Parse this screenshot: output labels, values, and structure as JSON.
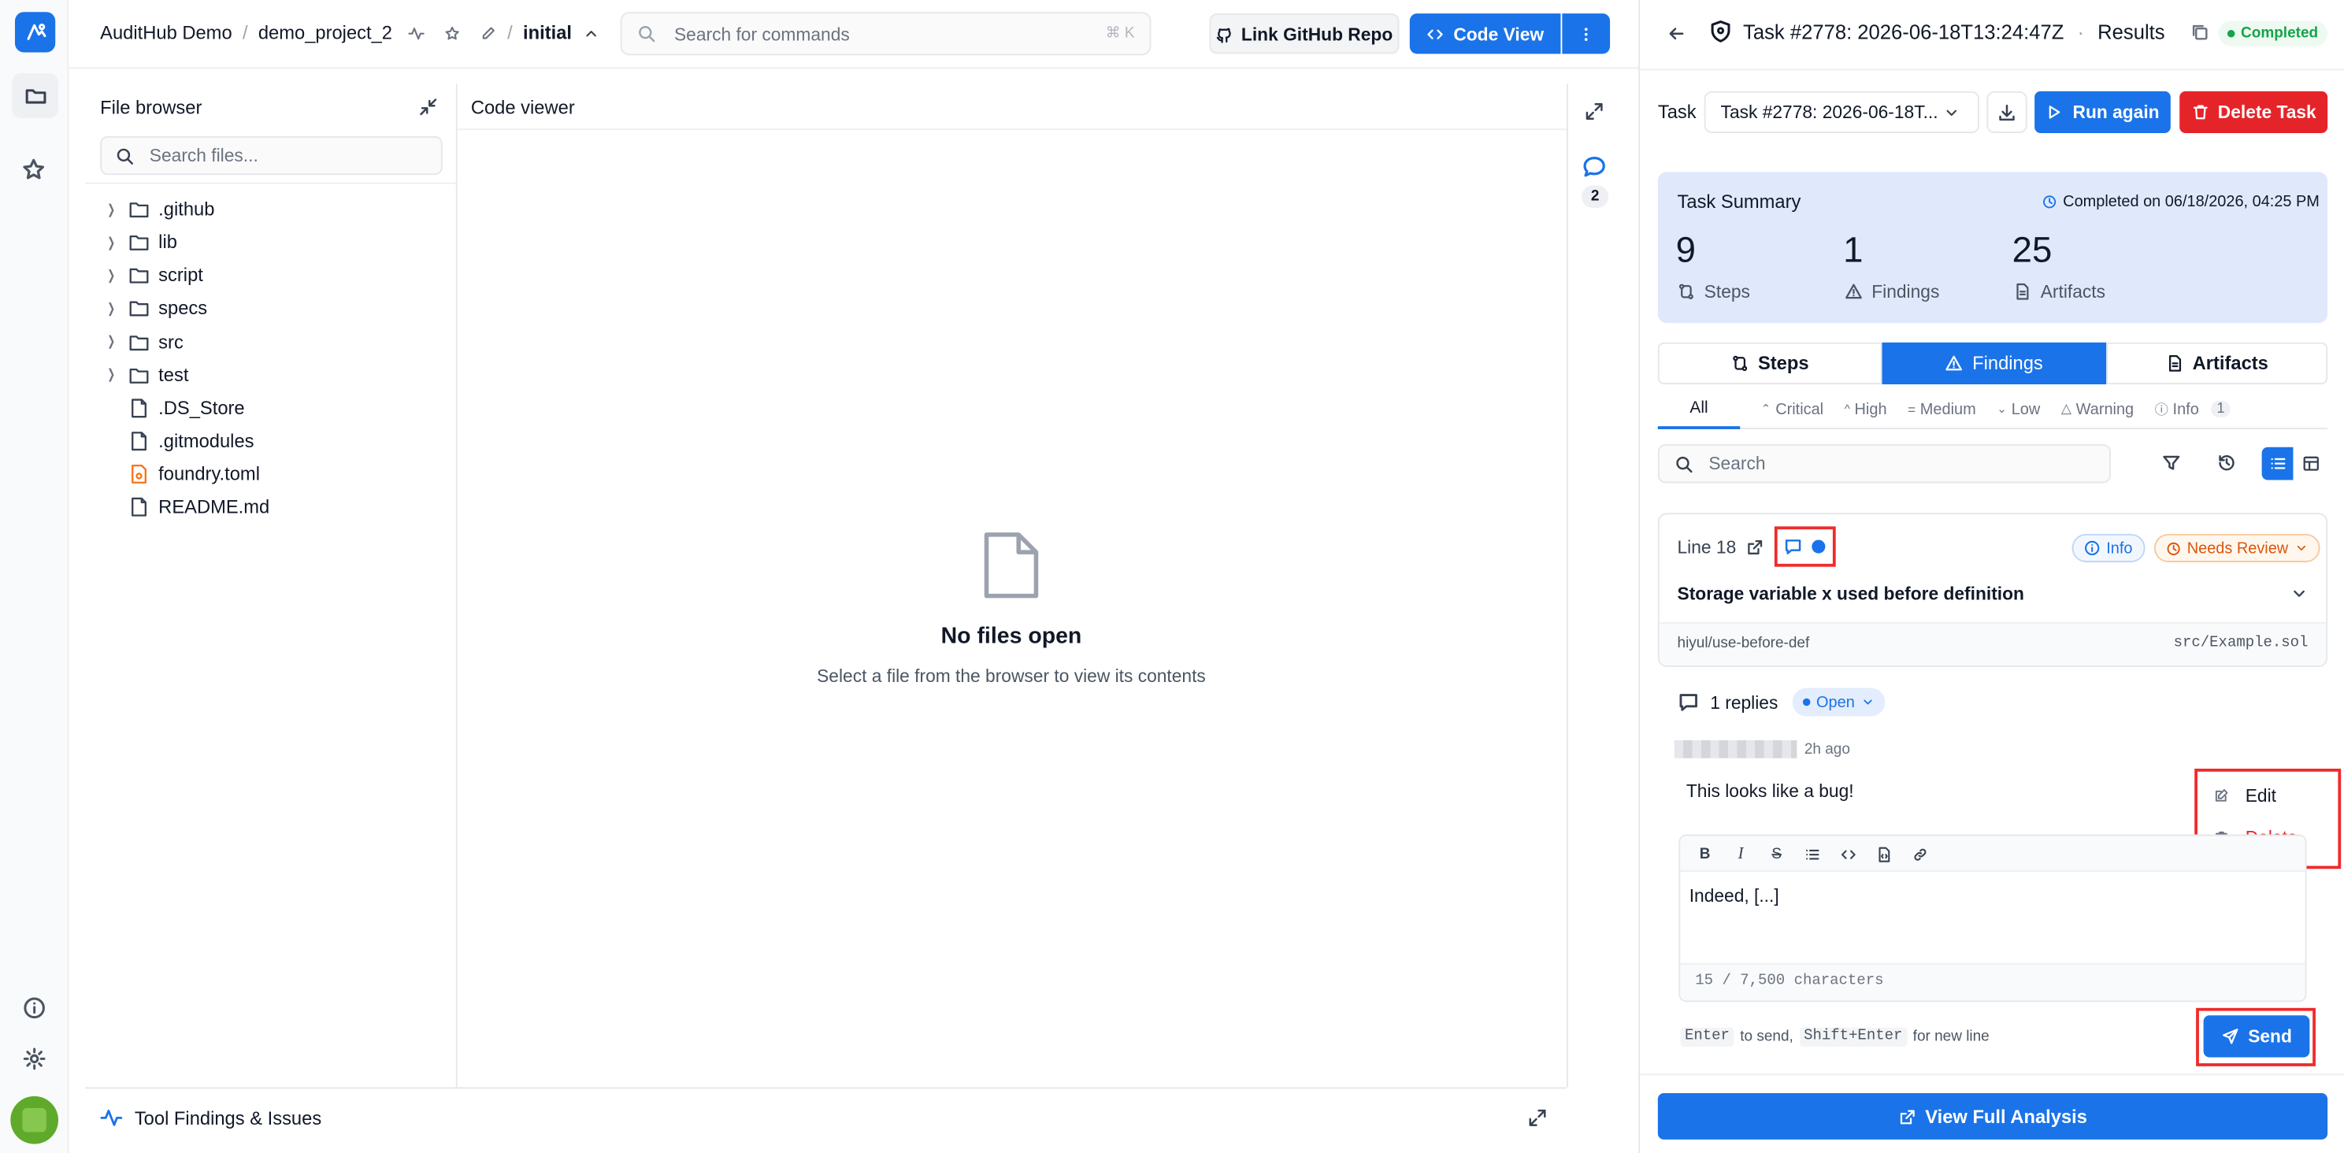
{
  "topbar": {
    "project": "AuditHub Demo",
    "sep1": "/",
    "repo": "demo_project_2",
    "sep2": "/",
    "branch": "initial",
    "command_placeholder": "Search for commands",
    "command_shortcut": "⌘ K",
    "link_github_label": "Link GitHub Repo",
    "code_view_label": "Code View"
  },
  "file_browser": {
    "title": "File browser",
    "search_placeholder": "Search files...",
    "items": [
      {
        "name": ".github",
        "type": "folder"
      },
      {
        "name": "lib",
        "type": "folder"
      },
      {
        "name": "script",
        "type": "folder"
      },
      {
        "name": "specs",
        "type": "folder"
      },
      {
        "name": "src",
        "type": "folder"
      },
      {
        "name": "test",
        "type": "folder"
      },
      {
        "name": ".DS_Store",
        "type": "file"
      },
      {
        "name": ".gitmodules",
        "type": "file"
      },
      {
        "name": "foundry.toml",
        "type": "toml"
      },
      {
        "name": "README.md",
        "type": "file"
      }
    ]
  },
  "code_viewer": {
    "title": "Code viewer",
    "empty_title": "No files open",
    "empty_subtitle": "Select a file from the browser to view its contents"
  },
  "comments_rail": {
    "count": "2"
  },
  "bottom_bar": {
    "label": "Tool Findings & Issues"
  },
  "task_header": {
    "title": "Task #2778: 2026-06-18T13:24:47Z",
    "dot": "·",
    "section": "Results",
    "status": "Completed"
  },
  "task_toolbar": {
    "label": "Task",
    "selected": "Task #2778: 2026-06-18T...",
    "run_again": "Run again",
    "delete_task": "Delete Task"
  },
  "summary": {
    "title": "Task Summary",
    "completed_on": "Completed on 06/18/2026, 04:25 PM",
    "steps_value": "9",
    "steps_label": "Steps",
    "findings_value": "1",
    "findings_label": "Findings",
    "artifacts_value": "25",
    "artifacts_label": "Artifacts"
  },
  "main_tabs": [
    "Steps",
    "Findings",
    "Artifacts"
  ],
  "severity_tabs": {
    "all": "All",
    "critical": "Critical",
    "high": "High",
    "medium": "Medium",
    "low": "Low",
    "warning": "Warning",
    "info": "Info",
    "info_count": "1"
  },
  "findings_search": {
    "placeholder": "Search"
  },
  "finding": {
    "line": "Line 18",
    "severity": "Info",
    "review_status": "Needs Review",
    "title": "Storage variable x used before definition",
    "detector": "hiyul/use-before-def",
    "file": "src/Example.sol"
  },
  "thread": {
    "replies": "1 replies",
    "status": "Open",
    "time": "2h ago",
    "comment": "This looks like a bug!",
    "menu_edit": "Edit",
    "menu_delete": "Delete",
    "reply_text": "Indeed, [...]",
    "char_count": "15 / 7,500 characters",
    "hint_enter": "Enter",
    "hint_to_send": "to send,",
    "hint_shift": "Shift+Enter",
    "hint_newline": "for new line",
    "send_label": "Send"
  },
  "footer": {
    "view_full": "View Full Analysis"
  },
  "colors": {
    "accent": "#1a73e8",
    "danger": "#e5242a",
    "success": "#16a34a",
    "highlight": "#ef2b2b"
  }
}
